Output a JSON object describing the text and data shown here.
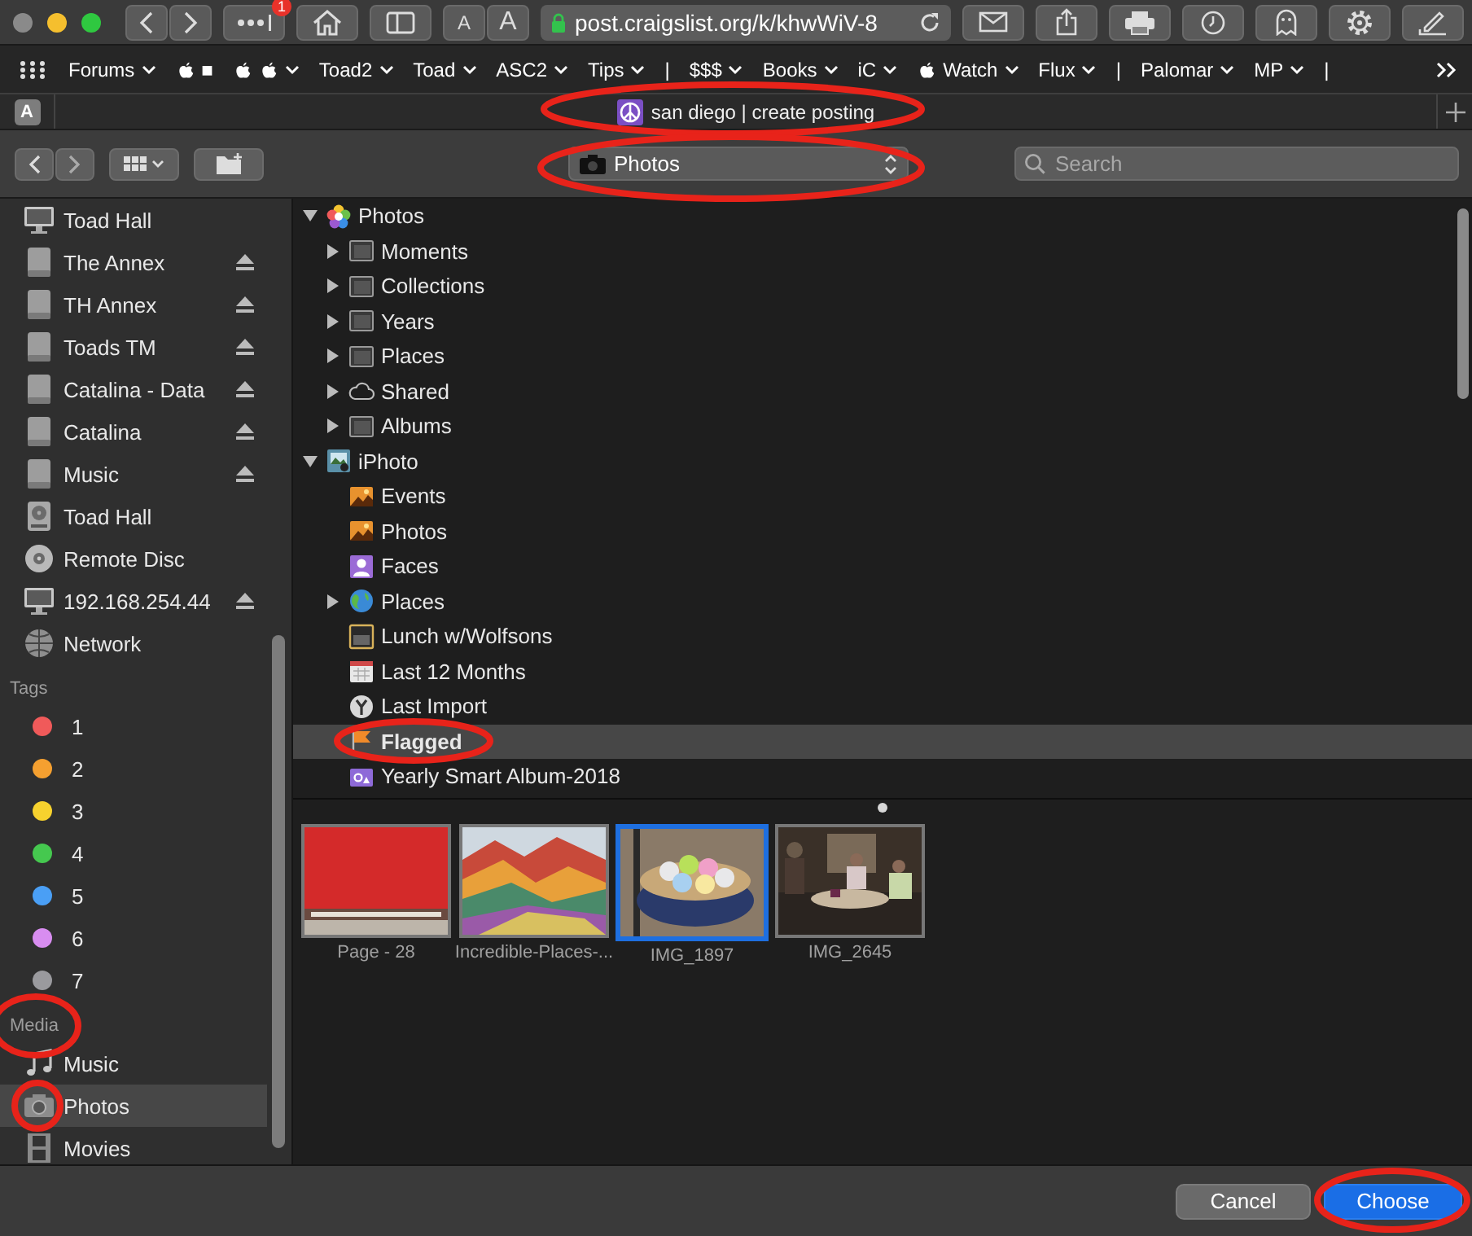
{
  "browser": {
    "badge": "1",
    "font_buttons": [
      "A",
      "A"
    ],
    "url": "post.craigslist.org/k/khwWiV-8"
  },
  "bookmarks": [
    {
      "label": "Forums",
      "kind": "text",
      "dropdown": true
    },
    {
      "label": "■",
      "kind": "apple",
      "dropdown": false
    },
    {
      "kind": "apple-pair",
      "dropdown": true
    },
    {
      "label": "Toad2",
      "kind": "text",
      "dropdown": true
    },
    {
      "label": "Toad",
      "kind": "text",
      "dropdown": true
    },
    {
      "label": "ASC2",
      "kind": "text",
      "dropdown": true
    },
    {
      "label": "Tips",
      "kind": "text",
      "dropdown": true
    },
    {
      "label": "|",
      "kind": "text",
      "dropdown": false
    },
    {
      "label": "$$$",
      "kind": "text",
      "dropdown": true
    },
    {
      "label": "Books",
      "kind": "text",
      "dropdown": true
    },
    {
      "label": "iC",
      "kind": "text",
      "dropdown": true
    },
    {
      "label": "Watch",
      "kind": "apple",
      "dropdown": true
    },
    {
      "label": "Flux",
      "kind": "text",
      "dropdown": true
    },
    {
      "label": "|",
      "kind": "text",
      "dropdown": false
    },
    {
      "label": "Palomar",
      "kind": "text",
      "dropdown": true
    },
    {
      "label": "MP",
      "kind": "text",
      "dropdown": true
    },
    {
      "label": "|",
      "kind": "text",
      "dropdown": false
    }
  ],
  "tab": {
    "favicon": "A",
    "title": "san diego | create posting"
  },
  "dialog": {
    "location": "Photos",
    "search_placeholder": "Search"
  },
  "sidebar": {
    "devices": [
      {
        "label": "Toad Hall",
        "kind": "monitor",
        "eject": false,
        "selected": false
      },
      {
        "label": "The Annex",
        "kind": "drive",
        "eject": true,
        "selected": false
      },
      {
        "label": "TH Annex",
        "kind": "drive",
        "eject": true,
        "selected": false
      },
      {
        "label": "Toads TM",
        "kind": "drive",
        "eject": true,
        "selected": false
      },
      {
        "label": "Catalina - Data",
        "kind": "drive",
        "eject": true,
        "selected": false
      },
      {
        "label": "Catalina",
        "kind": "drive",
        "eject": true,
        "selected": false
      },
      {
        "label": "Music",
        "kind": "drive",
        "eject": true,
        "selected": false
      },
      {
        "label": "Toad Hall",
        "kind": "disc-drive",
        "eject": false,
        "selected": false
      },
      {
        "label": "Remote Disc",
        "kind": "disc",
        "eject": false,
        "selected": false
      },
      {
        "label": "192.168.254.44",
        "kind": "monitor",
        "eject": true,
        "selected": false
      },
      {
        "label": "Network",
        "kind": "globe",
        "eject": false,
        "selected": false
      }
    ],
    "tags_header": "Tags",
    "tags": [
      {
        "label": "1",
        "color": "#f05a5a"
      },
      {
        "label": "2",
        "color": "#f5a030"
      },
      {
        "label": "3",
        "color": "#f7d22e"
      },
      {
        "label": "4",
        "color": "#45c84f"
      },
      {
        "label": "5",
        "color": "#4a9ff5"
      },
      {
        "label": "6",
        "color": "#d88df0"
      },
      {
        "label": "7",
        "color": "#9a9a9e"
      }
    ],
    "media_header": "Media",
    "media": [
      {
        "label": "Music",
        "kind": "music-note",
        "selected": false
      },
      {
        "label": "Photos",
        "kind": "camera",
        "selected": true
      },
      {
        "label": "Movies",
        "kind": "film-strip",
        "selected": false
      }
    ]
  },
  "tree": [
    {
      "label": "Photos",
      "kind": "color-wheel",
      "expanded": true,
      "selected": false,
      "children": [
        {
          "label": "Moments",
          "kind": "album-stack",
          "expanded": false,
          "selected": false
        },
        {
          "label": "Collections",
          "kind": "album-stack",
          "expanded": false,
          "selected": false
        },
        {
          "label": "Years",
          "kind": "album-stack",
          "expanded": false,
          "selected": false
        },
        {
          "label": "Places",
          "kind": "album-stack",
          "expanded": false,
          "selected": false
        },
        {
          "label": "Shared",
          "kind": "cloud",
          "expanded": false,
          "selected": false
        },
        {
          "label": "Albums",
          "kind": "album-stack",
          "expanded": false,
          "selected": false
        }
      ]
    },
    {
      "label": "iPhoto",
      "kind": "photo-library",
      "expanded": true,
      "selected": false,
      "children": [
        {
          "label": "Events",
          "kind": "landscape",
          "selected": false
        },
        {
          "label": "Photos",
          "kind": "landscape",
          "selected": false
        },
        {
          "label": "Faces",
          "kind": "portrait",
          "selected": false
        },
        {
          "label": "Places",
          "kind": "globe-color",
          "expanded": false,
          "selected": false
        },
        {
          "label": "Lunch w/Wolfsons",
          "kind": "frame",
          "selected": false
        },
        {
          "label": "Last 12 Months",
          "kind": "calendar",
          "selected": false
        },
        {
          "label": "Last Import",
          "kind": "circle-badge",
          "selected": false
        },
        {
          "label": "Flagged",
          "kind": "flag",
          "selected": true
        },
        {
          "label": "Yearly Smart Album-2018",
          "kind": "smart-album",
          "selected": false
        }
      ]
    }
  ],
  "thumbnails": [
    {
      "caption": "Page - 28",
      "kind": "picture",
      "selected": false
    },
    {
      "caption": "Incredible-Places-...",
      "kind": "picture",
      "selected": false
    },
    {
      "caption": "IMG_1897",
      "kind": "picture",
      "selected": true
    },
    {
      "caption": "IMG_2645",
      "kind": "picture",
      "selected": false
    }
  ],
  "buttons": [
    {
      "label": "Cancel",
      "default": false
    },
    {
      "label": "Choose",
      "default": true
    }
  ]
}
